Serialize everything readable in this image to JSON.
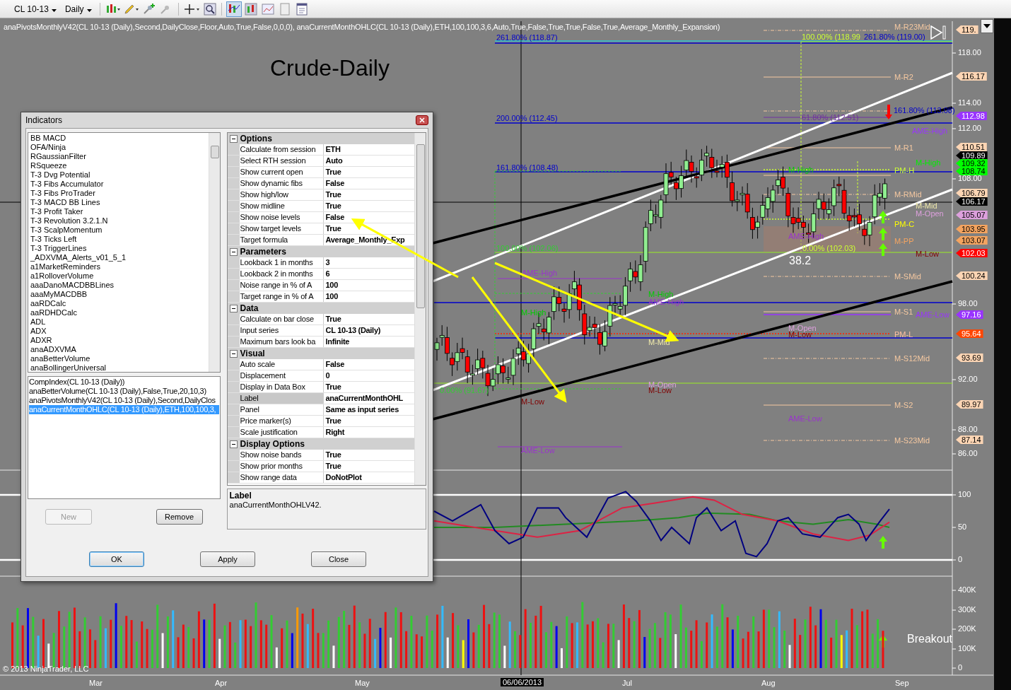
{
  "toolbar": {
    "instrument": "CL 10-13",
    "interval": "Daily"
  },
  "caption": "anaPivotsMonthlyV42(CL 10-13 (Daily),Second,DailyClose,Floor,Auto,True,False,0,0,0), anaCurrentMonthOHLC(CL 10-13 (Daily),ETH,100,100,3,6,Auto,True,False,True,True,False,True,Average_Monthly_Expansion)",
  "chart_title": "Crude-Daily",
  "price_axis": [
    "118.00",
    "114.00",
    "112.00",
    "108.00",
    "98.00",
    "92.00",
    "88.00",
    "86.00"
  ],
  "price_markers": [
    {
      "text": "119.",
      "color": "#fcd5b4"
    },
    {
      "text": "116.17",
      "color": "#fcd5b4"
    },
    {
      "text": "112.98",
      "color": "#9933ff"
    },
    {
      "text": "110.51",
      "color": "#fcd5b4"
    },
    {
      "text": "109.89",
      "color": "#000000"
    },
    {
      "text": "109.32",
      "color": "#00ff00"
    },
    {
      "text": "108.74",
      "color": "#00ff00"
    },
    {
      "text": "106.79",
      "color": "#fcd5b4"
    },
    {
      "text": "106.17",
      "color": "#000000"
    },
    {
      "text": "105.07",
      "color": "#dda0dd"
    },
    {
      "text": "103.95",
      "color": "#f4a460"
    },
    {
      "text": "103.07",
      "color": "#f4a460"
    },
    {
      "text": "102.03",
      "color": "#ff0000"
    },
    {
      "text": "100.24",
      "color": "#fcd5b4"
    },
    {
      "text": "97.16",
      "color": "#9933ff"
    },
    {
      "text": "95.64",
      "color": "#ff4500"
    },
    {
      "text": "93.69",
      "color": "#fcd5b4"
    },
    {
      "text": "89.97",
      "color": "#fcd5b4"
    },
    {
      "text": "87.14",
      "color": "#fcd5b4"
    }
  ],
  "level_labels": [
    {
      "text": "M-R23Mid",
      "color": "#f5c8a0"
    },
    {
      "text": "M-R2",
      "color": "#f5c8a0"
    },
    {
      "text": "AME-High",
      "color": "#9933ff"
    },
    {
      "text": "M-R1",
      "color": "#f5c8a0"
    },
    {
      "text": "M-High",
      "color": "#00ee00"
    },
    {
      "text": "PM-H",
      "color": "#ccff33"
    },
    {
      "text": "M-RMid",
      "color": "#f5c8a0"
    },
    {
      "text": "M-Mid",
      "color": "#eee8aa"
    },
    {
      "text": "M-Open",
      "color": "#dda0dd"
    },
    {
      "text": "PM-C",
      "color": "#ffff00"
    },
    {
      "text": "M-PP",
      "color": "#f4a460"
    },
    {
      "text": "M-Low",
      "color": "#800000"
    },
    {
      "text": "M-SMid",
      "color": "#f5c8a0"
    },
    {
      "text": "M-S1",
      "color": "#f5c8a0"
    },
    {
      "text": "AME-Low",
      "color": "#9933ff"
    },
    {
      "text": "PM-L",
      "color": "#ffc0a0"
    },
    {
      "text": "M-S12Mid",
      "color": "#f5c8a0"
    },
    {
      "text": "M-S2",
      "color": "#f5c8a0"
    },
    {
      "text": "M-S23Mid",
      "color": "#f5c8a0"
    }
  ],
  "chart_labels": [
    {
      "text": "261.80% (118.87)",
      "color": "#0000cc"
    },
    {
      "text": "100.00% (118.99",
      "color": "#ccff33"
    },
    {
      "text": "261.80% (119.00)",
      "color": "#0000cc"
    },
    {
      "text": "200.00% (112.45)",
      "color": "#0000cc"
    },
    {
      "text": "161.80% (113.08)",
      "color": "#0000cc"
    },
    {
      "text": "61.80% (112.51)",
      "color": "#7030a0"
    },
    {
      "text": "161.80% (108.48)",
      "color": "#0000cc"
    },
    {
      "text": "M-High",
      "color": "#00cc00"
    },
    {
      "text": "100.00% (102.06)",
      "color": "#33cc33"
    },
    {
      "text": "AME-High",
      "color": "#9933cc"
    },
    {
      "text": "0.00% (102.03)",
      "color": "#ccff33"
    },
    {
      "text": "38.2",
      "color": "#ffffff"
    },
    {
      "text": "AME-High",
      "color": "#9933cc"
    },
    {
      "text": "M-High",
      "color": "#00cc00"
    },
    {
      "text": "AME-High",
      "color": "#9933cc"
    },
    {
      "text": "M-High",
      "color": "#00cc00"
    },
    {
      "text": "M-Open",
      "color": "#dda0dd"
    },
    {
      "text": "M-Low",
      "color": "#800000"
    },
    {
      "text": "M-Mid",
      "color": "#eee8aa"
    },
    {
      "text": "0.00% (91.67)",
      "color": "#33cc33"
    },
    {
      "text": "M-Open",
      "color": "#dda0dd"
    },
    {
      "text": "M-Low",
      "color": "#800000"
    },
    {
      "text": "M-Low",
      "color": "#800000"
    },
    {
      "text": "AME-Low",
      "color": "#9933cc"
    },
    {
      "text": "AME-Low",
      "color": "#9933cc"
    }
  ],
  "oscillator_axis": [
    "100",
    "50",
    "0"
  ],
  "volume_axis": [
    "400K",
    "300K",
    "200K",
    "100K",
    "0"
  ],
  "volume_label": "Breakout",
  "copyright": "© 2013 NinjaTrader, LLC",
  "date_axis": [
    "Mar",
    "Apr",
    "May",
    "Jul",
    "Aug",
    "Sep"
  ],
  "crosshair_date": "06/06/2013",
  "dialog": {
    "title": "Indicators",
    "available": [
      "BB MACD",
      "OFA/Ninja",
      "RGaussianFilter",
      "RSqueeze",
      "T-3 Dvg Potential",
      "T-3 Fibs Accumulator",
      "T-3 Fibs ProTrader",
      "T-3 MACD BB Lines",
      "T-3 Profit Taker",
      "T-3 Revolution 3.2.1.N",
      "T-3 ScalpMomentum",
      "T-3 Ticks Left",
      "T-3 TriggerLines",
      "_ADXVMA_Alerts_v01_5_1",
      "a1MarketReminders",
      "a1RolloverVolume",
      "aaaDanoMACDBBLines",
      "aaaMyMACDBB",
      "aaRDCalc",
      "aaRDHDCalc",
      "ADL",
      "ADX",
      "ADXR",
      "anaADXVMA",
      "anaBetterVolume",
      "anaBollingerUniversal"
    ],
    "applied": [
      {
        "text": "CompIndex(CL 10-13 (Daily))",
        "selected": false
      },
      {
        "text": "anaBetterVolume(CL 10-13 (Daily),False,True,20,10,3)",
        "selected": false
      },
      {
        "text": "anaPivotsMonthlyV42(CL 10-13 (Daily),Second,DailyClos",
        "selected": false
      },
      {
        "text": "anaCurrentMonthOHLC(CL 10-13 (Daily),ETH,100,100,3,",
        "selected": true
      }
    ],
    "list_buttons": [
      {
        "label": "New",
        "disabled": true
      },
      {
        "label": "Remove",
        "disabled": false
      }
    ],
    "grid": [
      {
        "category": "Options",
        "expanded": true,
        "rows": [
          {
            "name": "Calculate from session",
            "value": "ETH",
            "selected": false
          },
          {
            "name": "Select RTH session",
            "value": "Auto",
            "selected": false
          },
          {
            "name": "Show current open",
            "value": "True",
            "selected": false
          },
          {
            "name": "Show dynamic fibs",
            "value": "False",
            "selected": false
          },
          {
            "name": "Show high/low",
            "value": "True",
            "selected": false
          },
          {
            "name": "Show midline",
            "value": "True",
            "selected": false
          },
          {
            "name": "Show noise levels",
            "value": "False",
            "selected": false
          },
          {
            "name": "Show target levels",
            "value": "True",
            "selected": false
          },
          {
            "name": "Target formula",
            "value": "Average_Monthly_Exp",
            "selected": false
          }
        ]
      },
      {
        "category": "Parameters",
        "expanded": true,
        "rows": [
          {
            "name": "Lookback 1 in months",
            "value": "3",
            "selected": false
          },
          {
            "name": "Lookback 2 in months",
            "value": "6",
            "selected": false
          },
          {
            "name": "Noise range in % of A",
            "value": "100",
            "selected": false
          },
          {
            "name": "Target range in % of A",
            "value": "100",
            "selected": false
          }
        ]
      },
      {
        "category": "Data",
        "expanded": true,
        "rows": [
          {
            "name": "Calculate on bar close",
            "value": "True",
            "selected": false
          },
          {
            "name": "Input series",
            "value": "CL 10-13 (Daily)",
            "selected": false
          },
          {
            "name": "Maximum bars look ba",
            "value": "Infinite",
            "selected": false
          }
        ]
      },
      {
        "category": "Visual",
        "expanded": true,
        "rows": [
          {
            "name": "Auto scale",
            "value": "False",
            "selected": false
          },
          {
            "name": "Displacement",
            "value": "0",
            "selected": false
          },
          {
            "name": "Display in Data Box",
            "value": "True",
            "selected": false
          },
          {
            "name": "Label",
            "value": "anaCurrentMonthOHL",
            "selected": true
          },
          {
            "name": "Panel",
            "value": "Same as input series",
            "selected": false
          },
          {
            "name": "Price marker(s)",
            "value": "True",
            "selected": false
          },
          {
            "name": "Scale justification",
            "value": "Right",
            "selected": false
          }
        ]
      },
      {
        "category": "Display Options",
        "expanded": true,
        "rows": [
          {
            "name": "Show noise bands",
            "value": "True",
            "selected": false
          },
          {
            "name": "Show prior months",
            "value": "True",
            "selected": false
          },
          {
            "name": "Show range data",
            "value": "DoNotPlot",
            "selected": false
          }
        ]
      }
    ],
    "help": {
      "title": "Label",
      "text": "anaCurrentMonthOHLV42."
    },
    "buttons": [
      "OK",
      "Apply",
      "Close"
    ]
  }
}
